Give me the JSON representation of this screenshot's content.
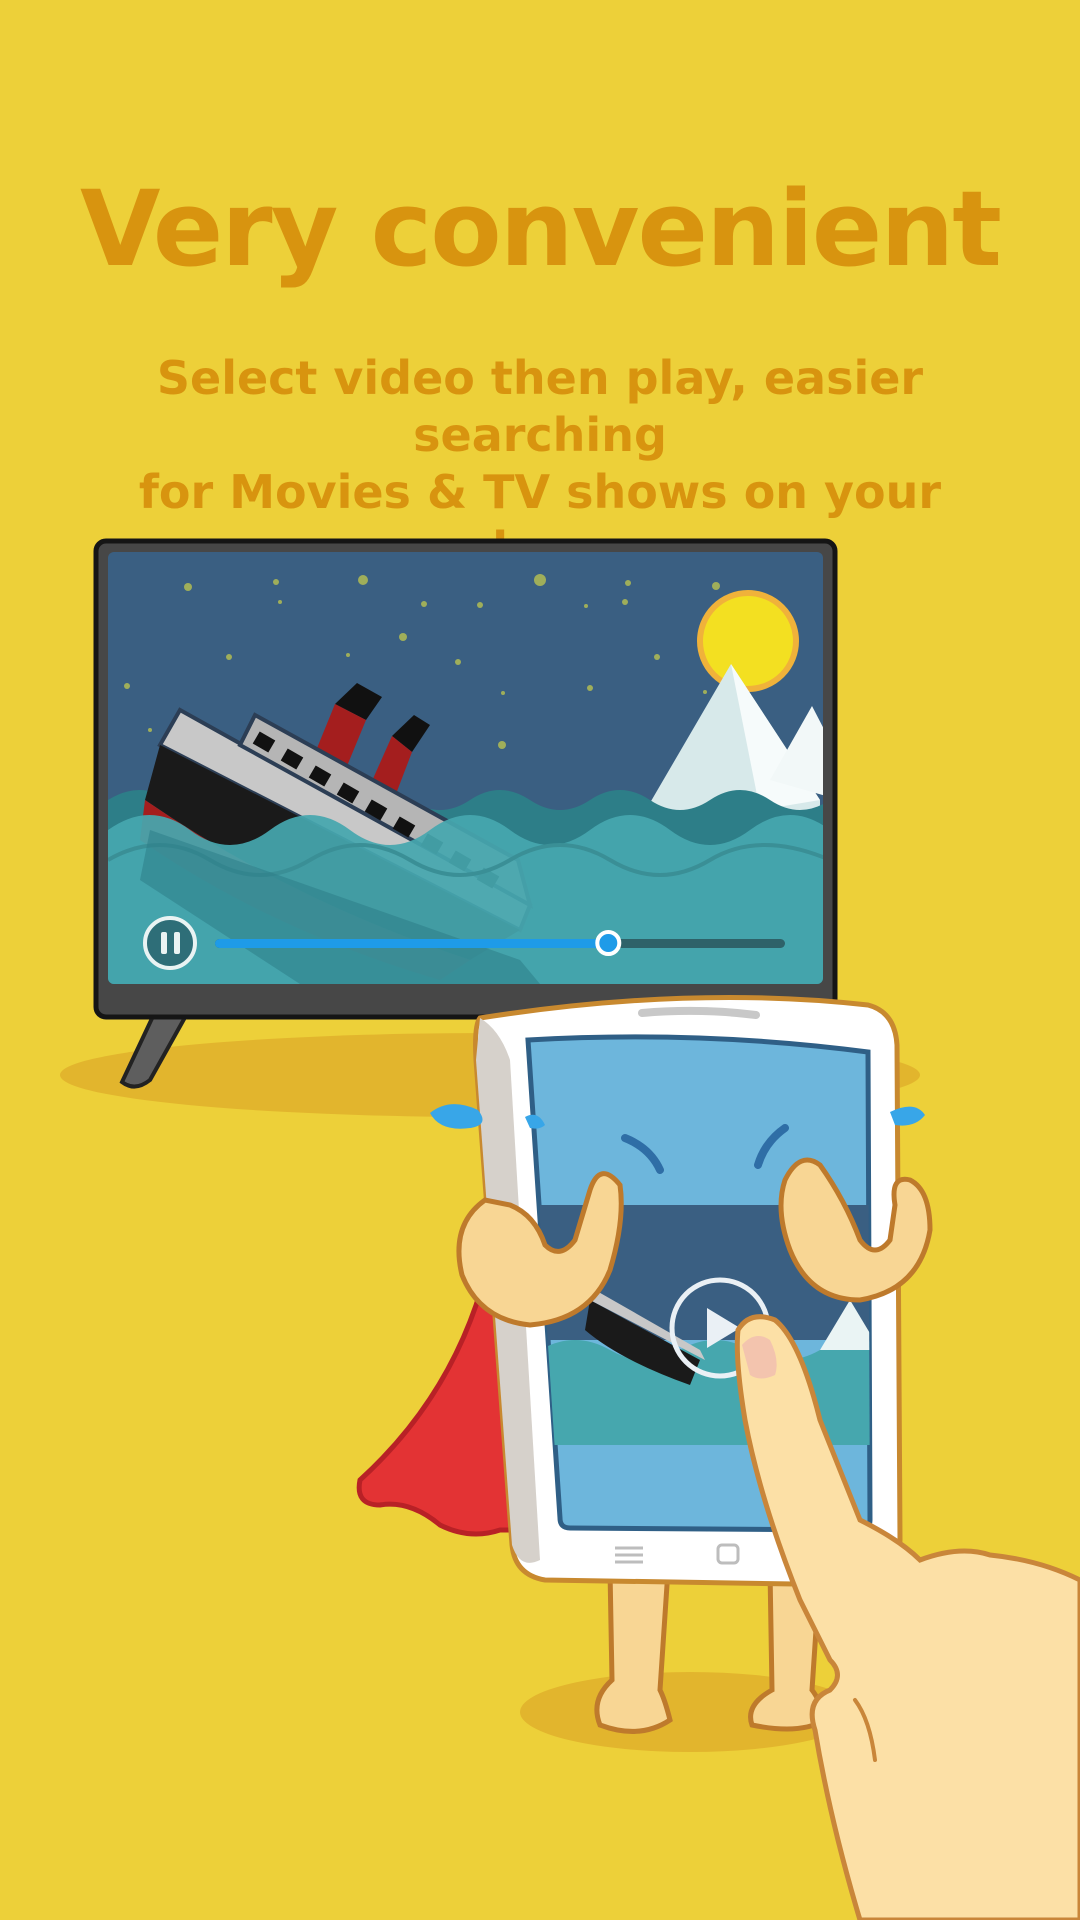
{
  "header": {
    "title": "Very convenient",
    "subtitle_line1": "Select video then play, easier searching",
    "subtitle_line2": "for Movies & TV shows on your phone"
  },
  "colors": {
    "background": "#EDD039",
    "text": "#D8940F",
    "progress_accent": "#1E9BE8"
  },
  "tv_player": {
    "control_icon": "pause-icon",
    "progress": 0.69
  },
  "phone_player": {
    "control_icon": "play-icon"
  }
}
